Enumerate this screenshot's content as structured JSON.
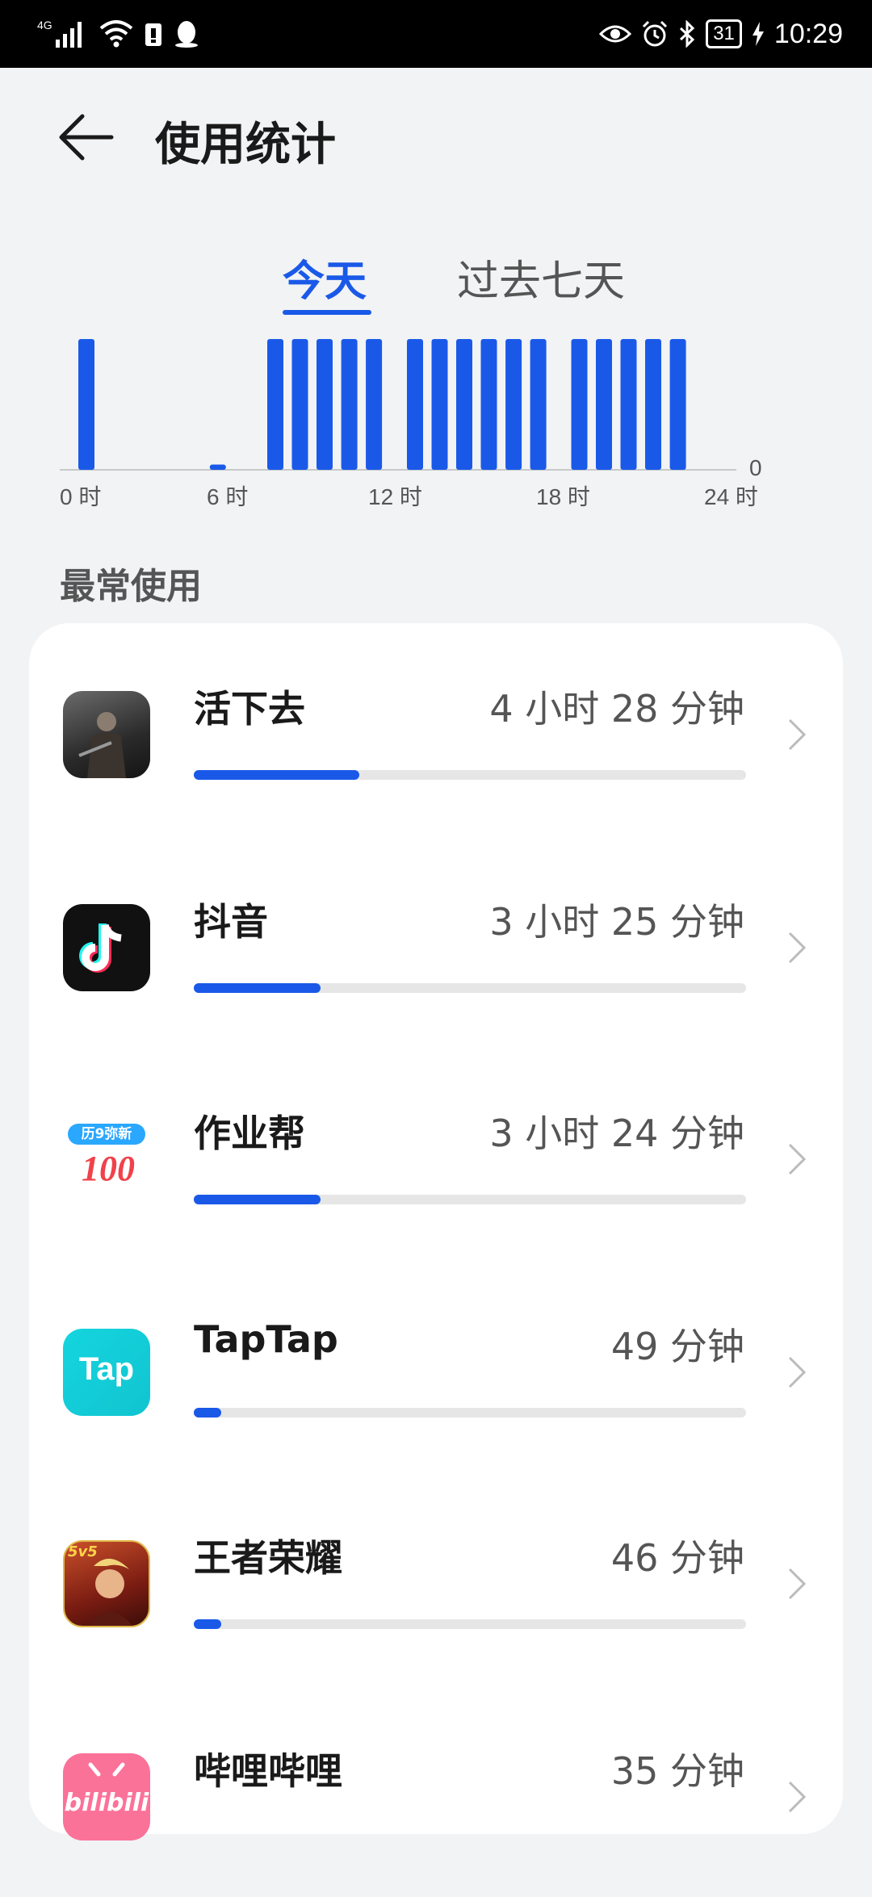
{
  "status_bar": {
    "network": "4G",
    "network_small": "4G",
    "battery": "31",
    "time": "10:29",
    "icons": [
      "signal-icon",
      "wifi-icon",
      "sim-icon",
      "qq-icon",
      "eye-icon",
      "alarm-icon",
      "bluetooth-icon",
      "charging-icon"
    ]
  },
  "header": {
    "title": "使用统计"
  },
  "tabs": [
    {
      "label": "今天",
      "selected": true
    },
    {
      "label": "过去七天",
      "selected": false
    }
  ],
  "chart_data": {
    "type": "bar",
    "x_ticks": [
      "0 时",
      "6 时",
      "12 时",
      "18 时",
      "24 时"
    ],
    "y_zero_label": "0",
    "hours": [
      0,
      1,
      2,
      3,
      4,
      5,
      6,
      7,
      8,
      9,
      10,
      11,
      12,
      13,
      14,
      15,
      16,
      17,
      18,
      19,
      20,
      21,
      22,
      23
    ],
    "values": [
      1,
      0,
      0,
      0,
      0,
      0.04,
      0,
      0,
      1,
      1,
      1,
      1,
      1,
      0,
      1,
      1,
      1,
      1,
      1,
      1,
      1,
      1,
      1,
      1
    ],
    "bars_detail": [
      {
        "start_hour": 0.5,
        "value": 1
      },
      {
        "start_hour": 5.3,
        "value": 0.04
      },
      {
        "start_hour": 7.4,
        "value": 1
      },
      {
        "start_hour": 8.3,
        "value": 1
      },
      {
        "start_hour": 9.2,
        "value": 1
      },
      {
        "start_hour": 10.1,
        "value": 1
      },
      {
        "start_hour": 11.0,
        "value": 1
      },
      {
        "start_hour": 12.5,
        "value": 1
      },
      {
        "start_hour": 13.4,
        "value": 1
      },
      {
        "start_hour": 14.3,
        "value": 1
      },
      {
        "start_hour": 15.2,
        "value": 1
      },
      {
        "start_hour": 16.1,
        "value": 1
      },
      {
        "start_hour": 17.0,
        "value": 1
      },
      {
        "start_hour": 18.5,
        "value": 1
      },
      {
        "start_hour": 19.4,
        "value": 1
      },
      {
        "start_hour": 20.3,
        "value": 1
      },
      {
        "start_hour": 21.2,
        "value": 1
      },
      {
        "start_hour": 22.1,
        "value": 1
      }
    ],
    "color": "#1a59e8"
  },
  "section_title": "最常使用",
  "apps": [
    {
      "name": "活下去",
      "time": "4 小时 28 分钟",
      "fraction": 0.3,
      "icon": "game-survival-icon"
    },
    {
      "name": "抖音",
      "time": "3 小时 25 分钟",
      "fraction": 0.23,
      "icon": "douyin-icon"
    },
    {
      "name": "作业帮",
      "time": "3 小时 24 分钟",
      "fraction": 0.23,
      "icon": "zuoyebang-icon",
      "icon_text_top": "历9弥新",
      "icon_text_main": "100"
    },
    {
      "name": "TapTap",
      "time": "49 分钟",
      "fraction": 0.05,
      "icon": "taptap-icon",
      "icon_text_main": "Tap"
    },
    {
      "name": "王者荣耀",
      "time": "46 分钟",
      "fraction": 0.05,
      "icon": "honor-of-kings-icon",
      "icon_text_top": "5v5"
    },
    {
      "name": "哔哩哔哩",
      "time": "35 分钟",
      "fraction": 0.04,
      "icon": "bilibili-icon",
      "icon_text_main": "bilibili"
    }
  ],
  "colors": {
    "accent": "#1a59e8",
    "background": "#f1f3f5",
    "card": "#ffffff"
  }
}
